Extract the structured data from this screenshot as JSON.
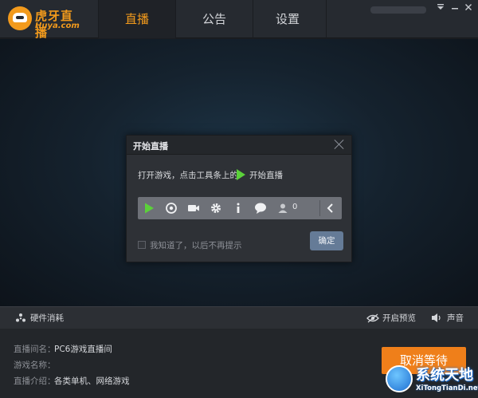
{
  "app": {
    "logo_text": "虎牙直播",
    "logo_sub": "Huya.com"
  },
  "tabs": [
    {
      "label": "直播",
      "active": true
    },
    {
      "label": "公告",
      "active": false
    },
    {
      "label": "设置",
      "active": false
    }
  ],
  "window_controls": {
    "menu_icon": "dropdown-icon",
    "minimize_icon": "minimize-icon",
    "close_icon": "close-icon"
  },
  "dialog": {
    "title": "开始直播",
    "instruction": "打开游戏，点击工具条上的",
    "instruction_action": "开始直播",
    "toolbar": {
      "icons": [
        "play-icon",
        "record-icon",
        "camera-icon",
        "gear-icon",
        "info-icon",
        "chat-icon",
        "user-icon",
        "collapse-icon"
      ],
      "viewer_count": "0"
    },
    "checkbox_label": "我知道了，以后不再提示",
    "checkbox_checked": false,
    "ok_label": "确定"
  },
  "status_bar": {
    "hardware_label": "硬件消耗",
    "preview_label": "开启预览",
    "sound_label": "声音"
  },
  "info": {
    "room_name_label": "直播间名：",
    "room_name_value": "PC6游戏直播间",
    "game_name_label": "游戏名称：",
    "game_name_value": "",
    "intro_label": "直播介绍：",
    "intro_value": "各类单机、网络游戏"
  },
  "cancel_button": "取消等待",
  "watermark": {
    "title": "系统天地",
    "sub": "XiTongTianDi.net"
  },
  "colors": {
    "accent": "#f29a1c",
    "play_green": "#5bd13a",
    "ok_button": "#657b97",
    "cancel_button": "#ef7f1a"
  }
}
